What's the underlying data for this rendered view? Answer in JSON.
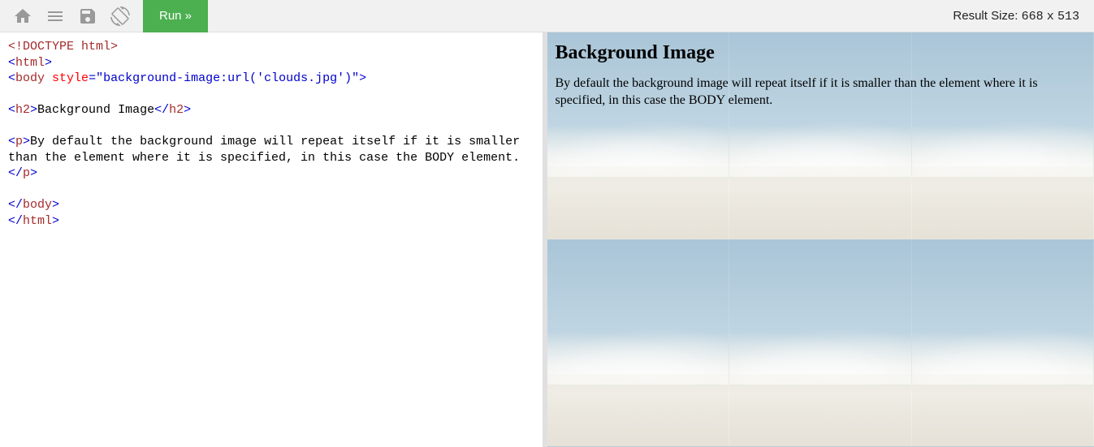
{
  "toolbar": {
    "run_label": "Run »"
  },
  "result_size": {
    "label": "Result Size:",
    "width": "668",
    "sep": "x",
    "height": "513"
  },
  "code": {
    "doctype": "<!DOCTYPE html>",
    "html_open_lt": "<",
    "html_open_tag": "html",
    "html_open_gt": ">",
    "body_open_lt": "<",
    "body_open_tag": "body",
    "body_attr_name": "style",
    "body_attr_eq": "=",
    "body_attr_val": "\"background-image:url('clouds.jpg')\"",
    "body_open_gt": ">",
    "h2_open": "<h2>",
    "h2_text": "Background Image",
    "h2_close": "</h2>",
    "p_open": "<p>",
    "p_text": "By default the background image will repeat itself if it is smaller than the element where it is specified, in this case the BODY element.",
    "p_close": "</p>",
    "body_close": "</body>",
    "html_close": "</html>"
  },
  "preview": {
    "heading": "Background Image",
    "paragraph": "By default the background image will repeat itself if it is smaller than the element where it is specified, in this case the BODY element."
  }
}
